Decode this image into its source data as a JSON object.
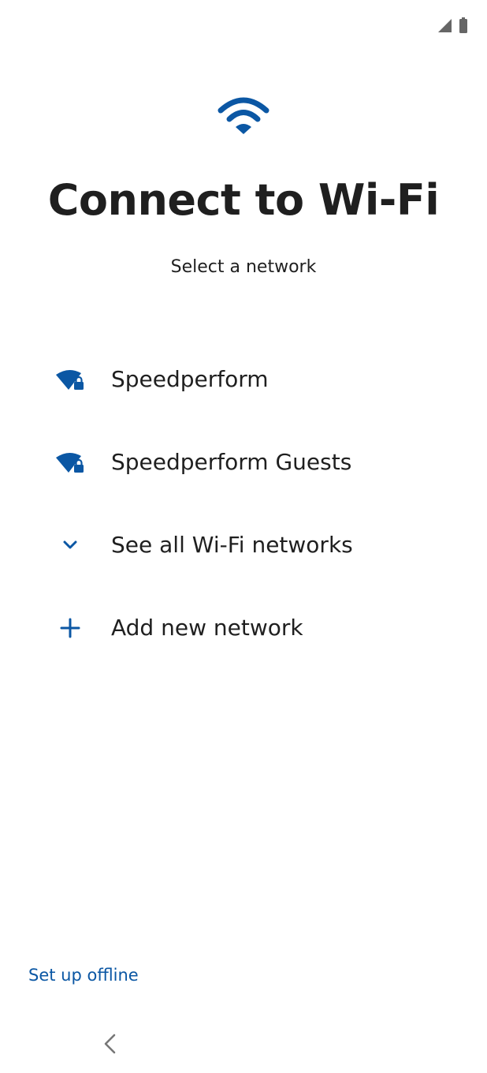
{
  "status_bar": {
    "icons": [
      "cell-signal-icon",
      "battery-icon"
    ]
  },
  "header": {
    "icon": "wifi-icon",
    "title": "Connect to Wi-Fi",
    "subtitle": "Select a network"
  },
  "networks": [
    {
      "label": "Speedperform",
      "icon": "wifi-locked-icon"
    },
    {
      "label": "Speedperform Guests",
      "icon": "wifi-locked-icon"
    }
  ],
  "actions": {
    "see_all": {
      "label": "See all Wi-Fi networks",
      "icon": "chevron-down-icon"
    },
    "add_network": {
      "label": "Add new network",
      "icon": "plus-icon"
    }
  },
  "footer": {
    "offline_label": "Set up offline",
    "back_icon": "chevron-left-icon"
  },
  "colors": {
    "accent": "#0b57a4",
    "text": "#1f1f1f",
    "status_icon": "#666666",
    "background": "#ffffff"
  }
}
